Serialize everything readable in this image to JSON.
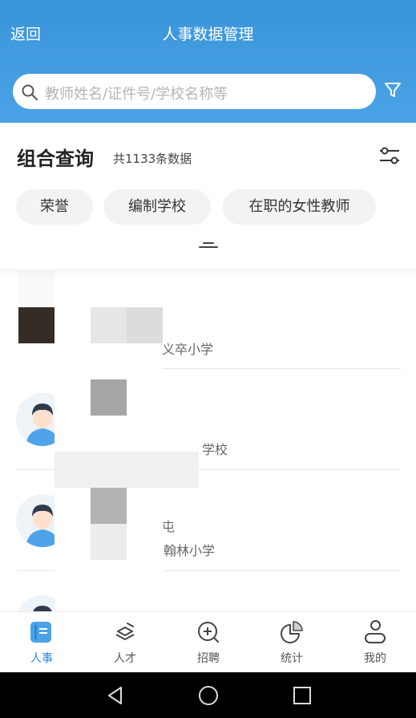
{
  "header": {
    "back_label": "返回",
    "title": "人事数据管理",
    "search_placeholder": "教师姓名/证件号/学校名称等"
  },
  "query": {
    "title": "组合查询",
    "count_text": "共1133条数据",
    "chips": [
      "荣誉",
      "编制学校",
      "在职的女性教师"
    ]
  },
  "list": {
    "rows": [
      {
        "school": "义卒小学"
      },
      {
        "school": "学校"
      },
      {
        "school": "翰林小学",
        "extra": "屯"
      }
    ]
  },
  "tabs": [
    {
      "label": "人事",
      "icon": "personnel-icon",
      "active": true
    },
    {
      "label": "人才",
      "icon": "talent-icon",
      "active": false
    },
    {
      "label": "招聘",
      "icon": "recruit-icon",
      "active": false
    },
    {
      "label": "统计",
      "icon": "stats-icon",
      "active": false
    },
    {
      "label": "我的",
      "icon": "profile-icon",
      "active": false
    }
  ],
  "colors": {
    "header_blue": "#3a94d9",
    "active_tab": "#2e8ad8"
  }
}
